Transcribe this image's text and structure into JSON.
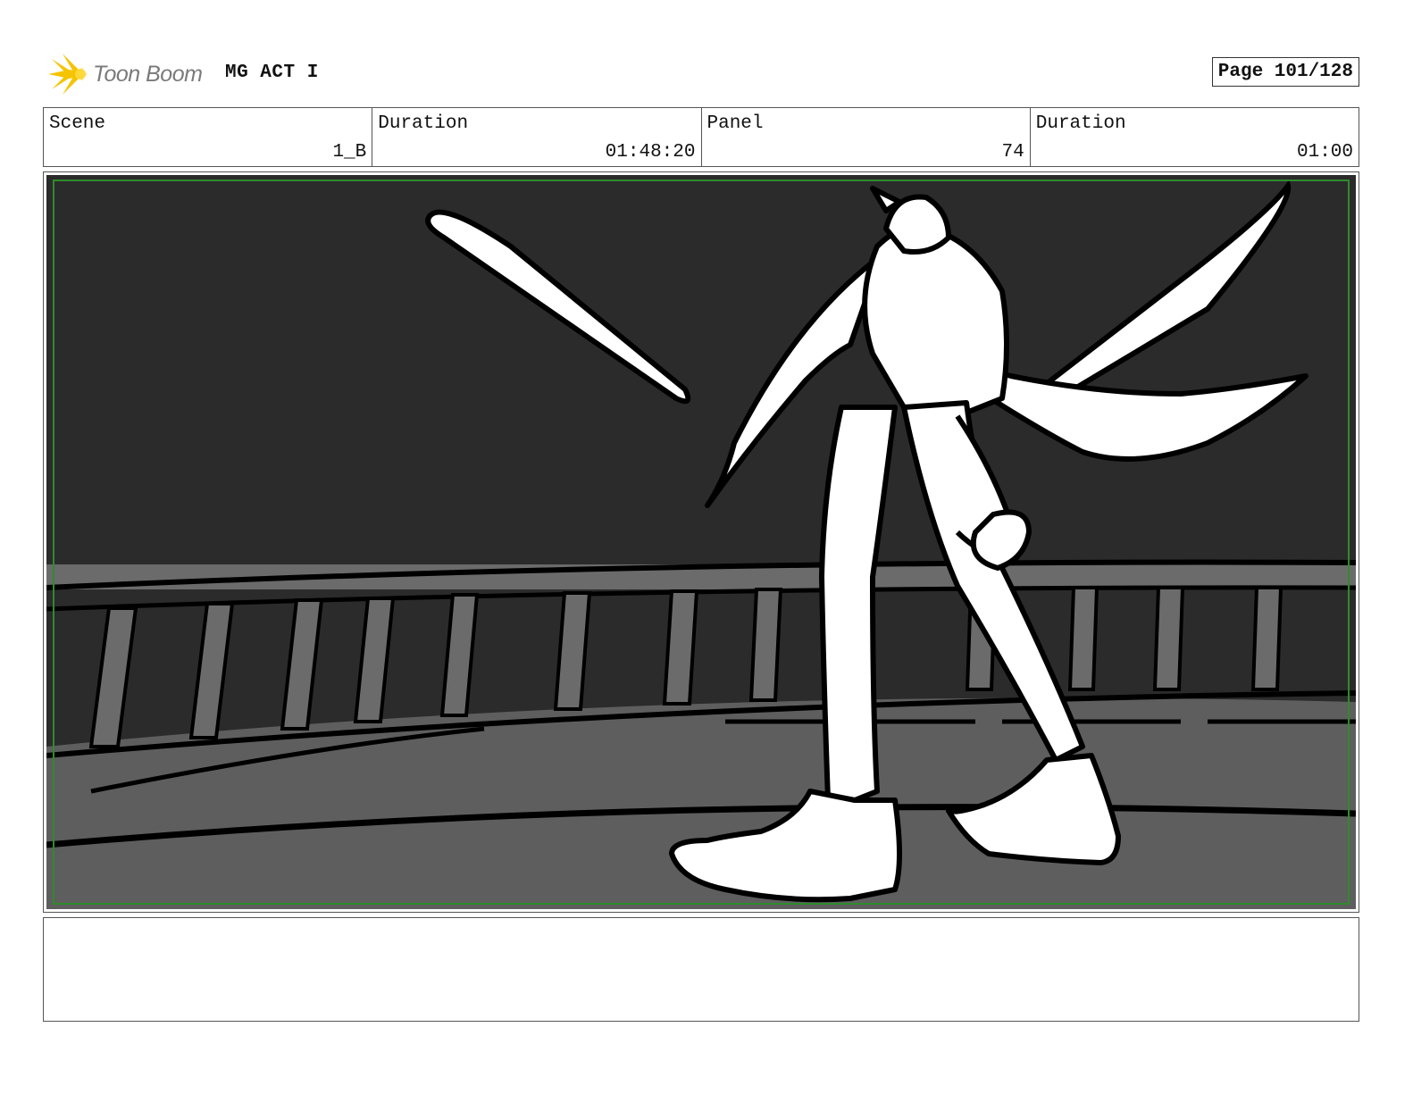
{
  "header": {
    "logo_text": "Toon Boom",
    "project_title": "MG ACT I",
    "page_label": "Page 101/128"
  },
  "info": {
    "scene_label": "Scene",
    "scene_value": "1_B",
    "scene_duration_label": "Duration",
    "scene_duration_value": "01:48:20",
    "panel_label": "Panel",
    "panel_value": "74",
    "panel_duration_label": "Duration",
    "panel_duration_value": "01:00"
  },
  "colors": {
    "logo_yellow": "#f5c400",
    "sky": "#2b2b2b",
    "railing": "#6b6b6b",
    "floor": "#5e5e5e",
    "safe_area": "#2e8b2e"
  },
  "notes": {
    "text": ""
  }
}
